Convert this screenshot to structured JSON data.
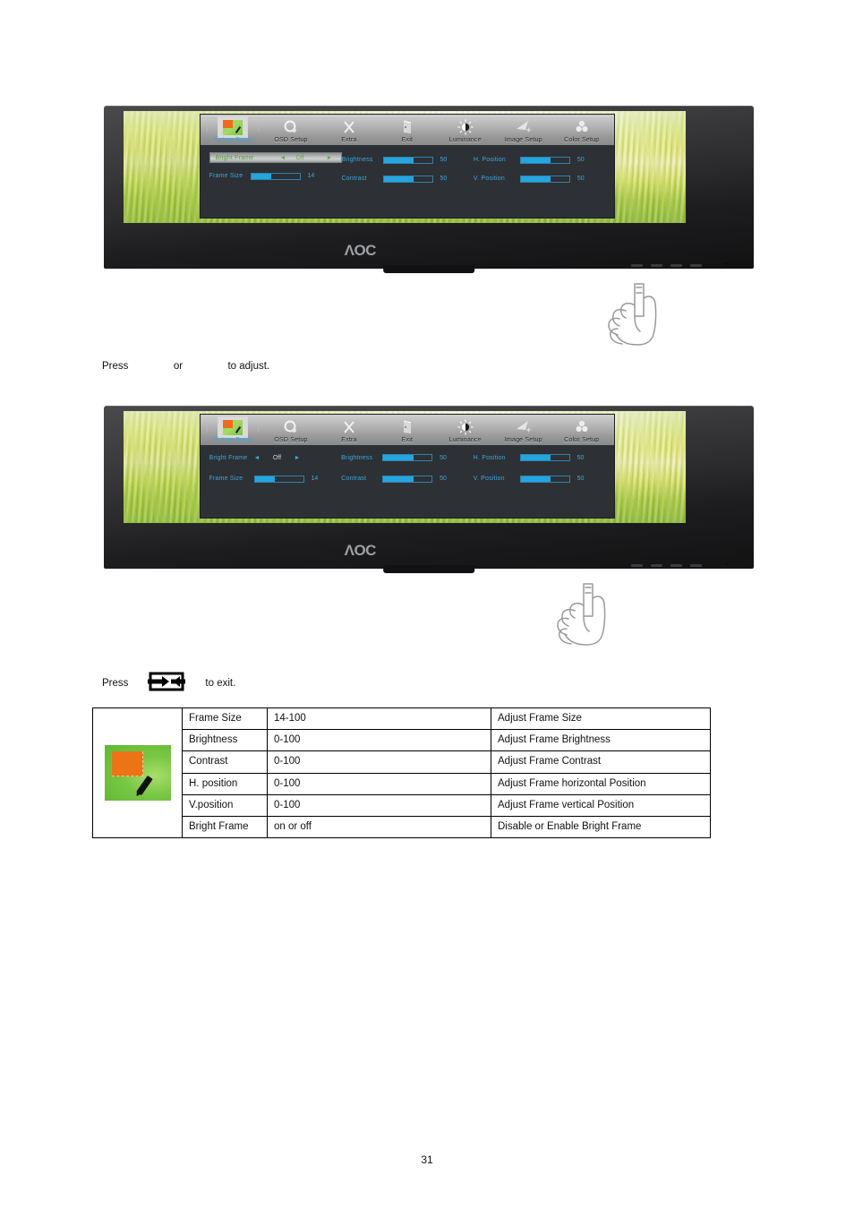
{
  "page": {
    "number": "31"
  },
  "osd": {
    "menu": [
      {
        "label": "Picture Boost",
        "icon": "picture-boost-icon",
        "selected": true
      },
      {
        "label": "OSD Setup",
        "icon": "osd-setup-icon",
        "selected": false
      },
      {
        "label": "Extra",
        "icon": "extra-tools-icon",
        "selected": false
      },
      {
        "label": "Exit",
        "icon": "exit-door-icon",
        "selected": false
      },
      {
        "label": "Luminance",
        "icon": "luminance-sun-icon",
        "selected": false
      },
      {
        "label": "Image Setup",
        "icon": "image-setup-icon",
        "selected": false
      },
      {
        "label": "Color Setup",
        "icon": "color-setup-icon",
        "selected": false
      }
    ],
    "panel1": {
      "highlighted_row": {
        "label": "Bright Frame",
        "value": "Off"
      },
      "frame_size": {
        "label": "Frame Size",
        "value": "14",
        "fill_pct": 42
      },
      "brightness": {
        "label": "Brightness",
        "value": "50",
        "fill_pct": 62
      },
      "contrast": {
        "label": "Contrast",
        "value": "50",
        "fill_pct": 62
      },
      "h_position": {
        "label": "H. Position",
        "value": "50",
        "fill_pct": 62
      },
      "v_position": {
        "label": "V. Position",
        "value": "50",
        "fill_pct": 62
      }
    },
    "panel2": {
      "bright_frame": {
        "label": "Bright Frame",
        "value": "Off",
        "arrow_left": "◄",
        "arrow_right": "►"
      },
      "frame_size": {
        "label": "Frame Size",
        "value": "14",
        "fill_pct": 42
      },
      "brightness": {
        "label": "Brightness",
        "value": "50",
        "fill_pct": 62
      },
      "contrast": {
        "label": "Contrast",
        "value": "50",
        "fill_pct": 62
      },
      "h_position": {
        "label": "H. Position",
        "value": "50",
        "fill_pct": 62
      },
      "v_position": {
        "label": "V. Position",
        "value": "50",
        "fill_pct": 62
      }
    },
    "brand": "ΛOC"
  },
  "instructions": {
    "adjust": {
      "prefix": "Press",
      "middle": "or",
      "suffix": "to adjust."
    },
    "exit": {
      "prefix": "Press",
      "suffix": "to exit."
    }
  },
  "table": {
    "rows": [
      {
        "name": "Frame Size",
        "range": "14-100",
        "desc": "Adjust Frame Size"
      },
      {
        "name": "Brightness",
        "range": "0-100",
        "desc": "Adjust Frame Brightness"
      },
      {
        "name": "Contrast",
        "range": "0-100",
        "desc": "Adjust Frame Contrast"
      },
      {
        "name": "H. position",
        "range": "0-100",
        "desc": "Adjust Frame horizontal Position"
      },
      {
        "name": "V.position",
        "range": "0-100",
        "desc": "Adjust Frame vertical Position"
      },
      {
        "name": "Bright Frame",
        "range": "on or off",
        "desc": "Disable or Enable Bright Frame"
      }
    ],
    "icon": "picture-boost-thumbnail"
  },
  "colors": {
    "osd_text": "#3ea7dd",
    "slider_fill": "#24a5e0",
    "accent_orange": "#ec7415",
    "accent_green": "#79c744"
  }
}
